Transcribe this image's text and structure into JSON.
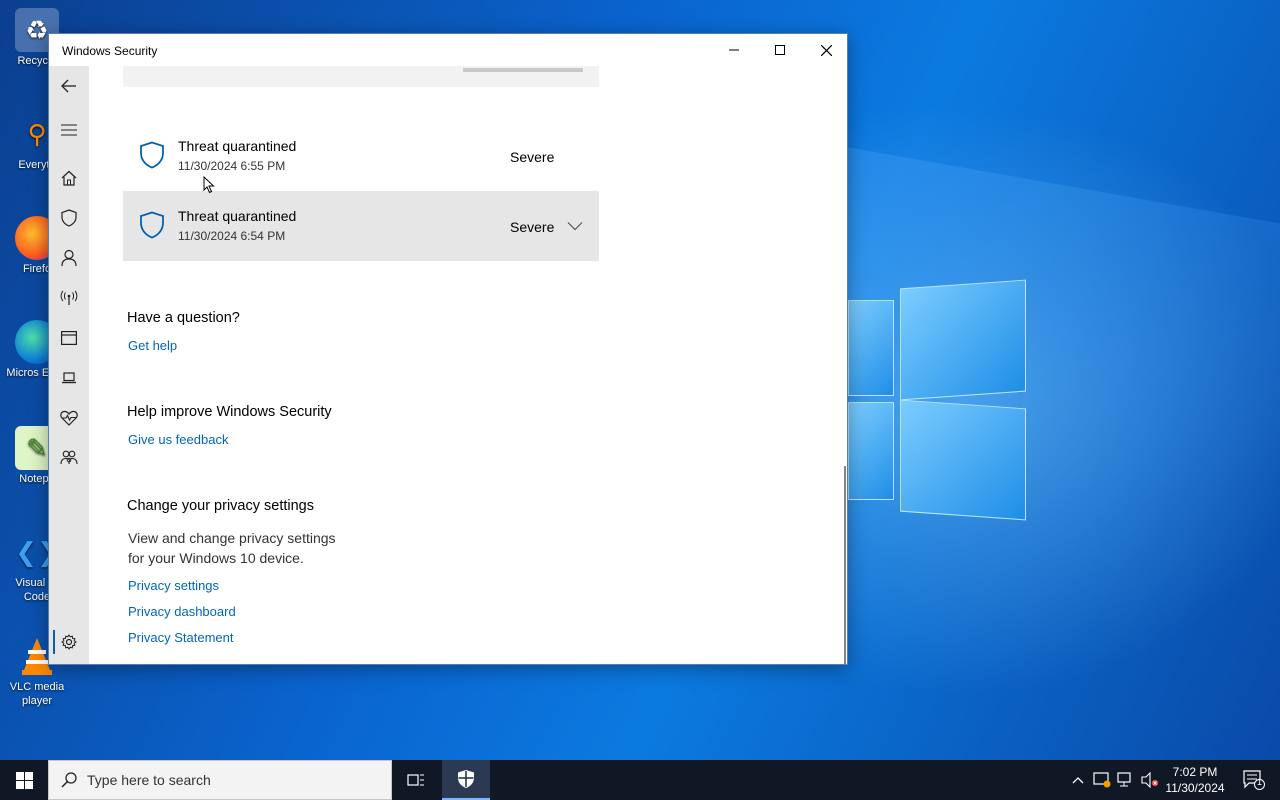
{
  "desktop": {
    "icons": [
      {
        "label": "Recycle",
        "icon": "recycle-bin-icon"
      },
      {
        "label": "Everyth",
        "icon": "everything-search-icon"
      },
      {
        "label": "Firefo",
        "icon": "firefox-icon"
      },
      {
        "label": "Micros Edge",
        "icon": "edge-icon"
      },
      {
        "label": "Notepa",
        "icon": "notepad-plus-icon"
      },
      {
        "label": "Visual St Code",
        "icon": "vscode-icon"
      },
      {
        "label": "VLC media player",
        "icon": "vlc-icon"
      }
    ]
  },
  "window": {
    "title": "Windows Security",
    "controls": {
      "minimize": "minimize-icon",
      "maximize": "maximize-icon",
      "close": "close-icon"
    }
  },
  "nav": {
    "items": [
      {
        "icon": "back-arrow-icon"
      },
      {
        "icon": "hamburger-menu-icon"
      },
      {
        "icon": "home-icon"
      },
      {
        "icon": "shield-icon"
      },
      {
        "icon": "person-icon"
      },
      {
        "icon": "wireless-antenna-icon"
      },
      {
        "icon": "app-browser-icon"
      },
      {
        "icon": "laptop-icon"
      },
      {
        "icon": "heart-pulse-icon"
      },
      {
        "icon": "family-icon"
      },
      {
        "icon": "gear-icon"
      }
    ]
  },
  "threats": [
    {
      "title": "Threat quarantined",
      "date": "11/30/2024 6:55 PM",
      "severity": "Severe"
    },
    {
      "title": "Threat quarantined",
      "date": "11/30/2024 6:54 PM",
      "severity": "Severe"
    }
  ],
  "help": {
    "heading": "Have a question?",
    "link": "Get help"
  },
  "improve": {
    "heading": "Help improve Windows Security",
    "link": "Give us feedback"
  },
  "privacy": {
    "heading": "Change your privacy settings",
    "line1": "View and change privacy settings",
    "line2": "for your Windows 10 device.",
    "links": [
      "Privacy settings",
      "Privacy dashboard",
      "Privacy Statement"
    ]
  },
  "taskbar": {
    "search_placeholder": "Type here to search",
    "time": "7:02 PM",
    "date": "11/30/2024",
    "notification_count": "1"
  },
  "colors": {
    "link": "#0067b8",
    "shield": "#0063b1",
    "taskbar": "#101826"
  }
}
